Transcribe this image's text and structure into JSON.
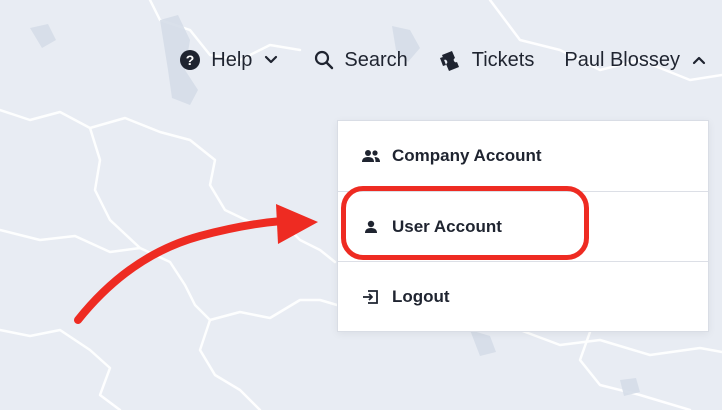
{
  "topbar": {
    "help_label": "Help",
    "search_label": "Search",
    "tickets_label": "Tickets",
    "user_label": "Paul Blossey"
  },
  "icons": {
    "help": "question-circle-icon",
    "search": "search-icon",
    "tickets": "tickets-icon",
    "company": "users-icon",
    "user": "user-icon",
    "logout": "logout-icon"
  },
  "dropdown": {
    "items": [
      {
        "label": "Company Account"
      },
      {
        "label": "User Account"
      },
      {
        "label": "Logout"
      }
    ]
  },
  "annotation": {
    "highlight_color": "#ee2b22",
    "arrow_color": "#ee2b22"
  }
}
